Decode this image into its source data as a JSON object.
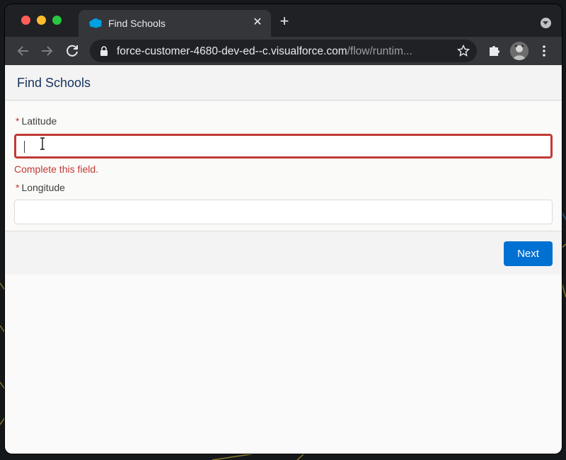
{
  "browser": {
    "tab_title": "Find Schools",
    "new_tab_symbol": "+",
    "close_symbol": "✕",
    "url_host": "force-customer-4680-dev-ed--c.visualforce.com",
    "url_path": "/flow/runtim..."
  },
  "page": {
    "title": "Find Schools",
    "fields": [
      {
        "label": "Latitude",
        "required_mark": "*",
        "value": "",
        "error": "Complete this field."
      },
      {
        "label": "Longitude",
        "required_mark": "*",
        "value": ""
      }
    ],
    "next_label": "Next"
  },
  "icons": {
    "favicon": "salesforce-cloud-icon",
    "back": "back-arrow-icon",
    "forward": "forward-arrow-icon",
    "reload": "reload-icon",
    "lock": "lock-icon",
    "star": "bookmark-star-icon",
    "extensions": "puzzle-icon",
    "menu": "kebab-menu-icon"
  },
  "colors": {
    "accent": "#0070d2",
    "error": "#c23934",
    "title": "#16325c"
  }
}
